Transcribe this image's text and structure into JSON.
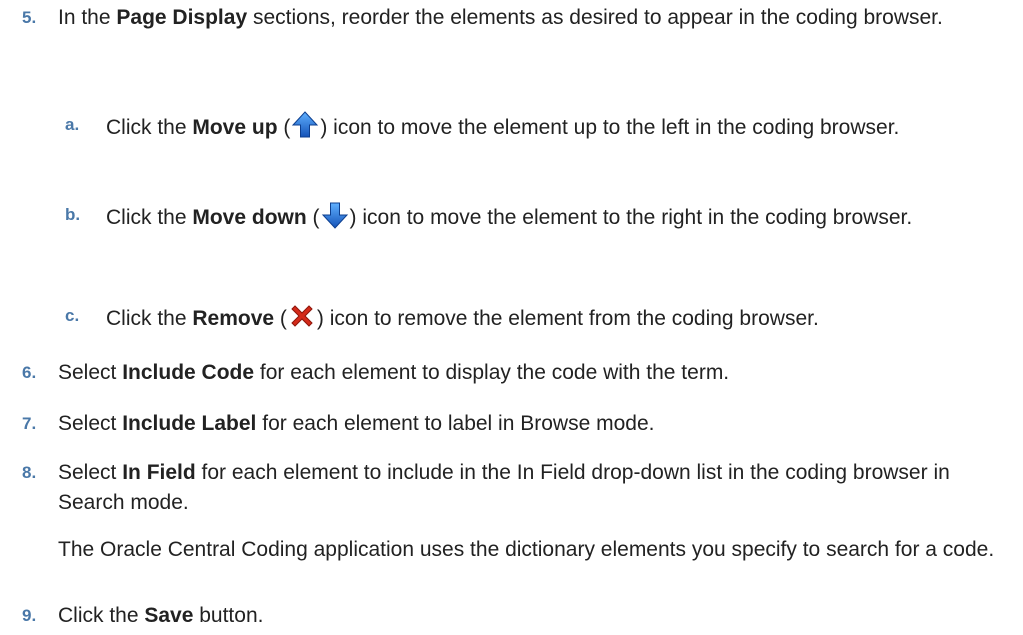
{
  "steps": {
    "s5": {
      "num": "5.",
      "pre": "In the ",
      "bold": "Page Display",
      "post": " sections, reorder the elements as desired to appear in the coding browser."
    },
    "s5a": {
      "num": "a.",
      "pre": "Click the ",
      "bold": "Move up",
      "open": " (",
      "icon": "arrow-up-icon",
      "post": ") icon to move the element up to the left in the coding browser."
    },
    "s5b": {
      "num": "b.",
      "pre": "Click the ",
      "bold": "Move down",
      "open": " (",
      "icon": "arrow-down-icon",
      "post": ") icon to move the element to the right in the coding browser."
    },
    "s5c": {
      "num": "c.",
      "pre": "Click the ",
      "bold": "Remove",
      "open": " (",
      "icon": "remove-x-icon",
      "post": ") icon to remove the element from the coding browser."
    },
    "s6": {
      "num": "6.",
      "pre": "Select ",
      "bold": "Include Code",
      "post": " for each element to display the code with the term."
    },
    "s7": {
      "num": "7.",
      "pre": "Select ",
      "bold": "Include Label",
      "post": " for each element to label in Browse mode."
    },
    "s8": {
      "num": "8.",
      "pre": "Select ",
      "bold": "In Field",
      "post": " for each element to include in the In Field drop-down list in the coding browser in Search mode.",
      "note": "The Oracle Central Coding application uses the dictionary elements you specify to search for a code."
    },
    "s9": {
      "num": "9.",
      "pre": "Click the ",
      "bold": "Save",
      "post": " button."
    }
  },
  "colors": {
    "step_number": "#4a78a8",
    "arrow_blue": "#1e6fd0",
    "remove_red": "#d42a1a"
  }
}
